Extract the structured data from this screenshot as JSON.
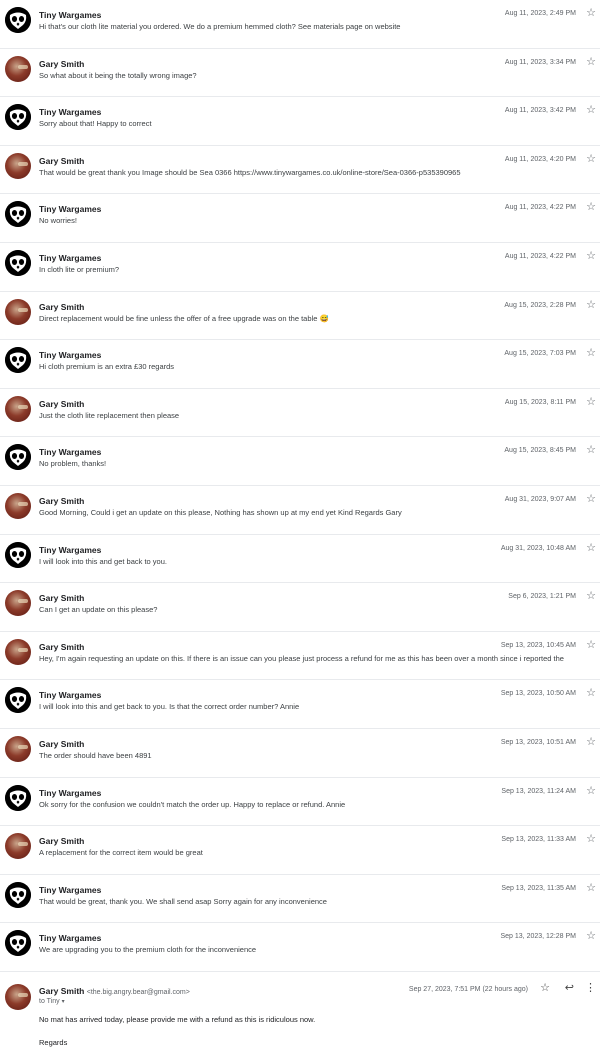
{
  "thread": {
    "messages": [
      {
        "sender": "Tiny Wargames",
        "avatar": "tiny",
        "snippet": "Hi that's our cloth lite material you ordered. We do a premium hemmed cloth? See materials page on website",
        "date": "Aug 11, 2023, 2:49 PM"
      },
      {
        "sender": "Gary Smith",
        "avatar": "gary",
        "snippet": "So what about it being the totally wrong image?",
        "date": "Aug 11, 2023, 3:34 PM"
      },
      {
        "sender": "Tiny Wargames",
        "avatar": "tiny",
        "snippet": "Sorry about that! Happy to correct",
        "date": "Aug 11, 2023, 3:42 PM"
      },
      {
        "sender": "Gary Smith",
        "avatar": "gary",
        "snippet": "That would be great thank you Image should be Sea 0366 https://www.tinywargames.co.uk/online-store/Sea-0366-p535390965",
        "date": "Aug 11, 2023, 4:20 PM"
      },
      {
        "sender": "Tiny Wargames",
        "avatar": "tiny",
        "snippet": "No worries!",
        "date": "Aug 11, 2023, 4:22 PM"
      },
      {
        "sender": "Tiny Wargames",
        "avatar": "tiny",
        "snippet": "In cloth lite or premium?",
        "date": "Aug 11, 2023, 4:22 PM"
      },
      {
        "sender": "Gary Smith",
        "avatar": "gary",
        "snippet": "Direct replacement would be fine unless the offer of a free upgrade was on the table 😅",
        "date": "Aug 15, 2023, 2:28 PM"
      },
      {
        "sender": "Tiny Wargames",
        "avatar": "tiny",
        "snippet": "Hi cloth premium is an extra £30 regards",
        "date": "Aug 15, 2023, 7:03 PM"
      },
      {
        "sender": "Gary Smith",
        "avatar": "gary",
        "snippet": "Just the cloth lite replacement then please",
        "date": "Aug 15, 2023, 8:11 PM"
      },
      {
        "sender": "Tiny Wargames",
        "avatar": "tiny",
        "snippet": "No problem, thanks!",
        "date": "Aug 15, 2023, 8:45 PM"
      },
      {
        "sender": "Gary Smith",
        "avatar": "gary",
        "snippet": "Good Morning, Could i get an update on this please, Nothing has shown up at my end yet Kind Regards Gary",
        "date": "Aug 31, 2023, 9:07 AM"
      },
      {
        "sender": "Tiny Wargames",
        "avatar": "tiny",
        "snippet": "I will look into this and get back to you.",
        "date": "Aug 31, 2023, 10:48 AM"
      },
      {
        "sender": "Gary Smith",
        "avatar": "gary",
        "snippet": "Can I get an update on this please?",
        "date": "Sep 6, 2023, 1:21 PM"
      },
      {
        "sender": "Gary Smith",
        "avatar": "gary",
        "snippet": "Hey, I'm again requesting an update on this. If there is an issue can you please just process a refund for me as this has been over a month since i reported the",
        "date": "Sep 13, 2023, 10:45 AM"
      },
      {
        "sender": "Tiny Wargames",
        "avatar": "tiny",
        "snippet": "I will look into this and get back to you. Is that the correct order number? Annie",
        "date": "Sep 13, 2023, 10:50 AM"
      },
      {
        "sender": "Gary Smith",
        "avatar": "gary",
        "snippet": "The order should have been 4891",
        "date": "Sep 13, 2023, 10:51 AM"
      },
      {
        "sender": "Tiny Wargames",
        "avatar": "tiny",
        "snippet": "Ok sorry for the confusion we couldn't match the order up. Happy to replace or refund. Annie",
        "date": "Sep 13, 2023, 11:24 AM"
      },
      {
        "sender": "Gary Smith",
        "avatar": "gary",
        "snippet": "A replacement for the correct item would be great",
        "date": "Sep 13, 2023, 11:33 AM"
      },
      {
        "sender": "Tiny Wargames",
        "avatar": "tiny",
        "snippet": "That would be great, thank you. We shall send asap Sorry again for any inconvenience",
        "date": "Sep 13, 2023, 11:35 AM"
      },
      {
        "sender": "Tiny Wargames",
        "avatar": "tiny",
        "snippet": "We are upgrading you to the premium cloth for the inconvenience",
        "date": "Sep 13, 2023, 12:28 PM"
      }
    ],
    "expanded": {
      "sender": "Gary Smith",
      "email": "<the.big.angry.bear@gmail.com>",
      "to": "to Tiny",
      "date": "Sep 27, 2023, 7:51 PM (22 hours ago)",
      "body_1": "No mat has arrived today, please provide me with a refund as this is ridiculous now.",
      "body_2": "Regards"
    }
  },
  "icons": {
    "star": "star-outline-icon",
    "reply": "reply-icon",
    "more": "more-vert-icon",
    "caret": "caret-down-icon"
  },
  "colors": {
    "divider": "#e8eaed",
    "text_primary": "#202124",
    "text_secondary": "#5f6368"
  }
}
